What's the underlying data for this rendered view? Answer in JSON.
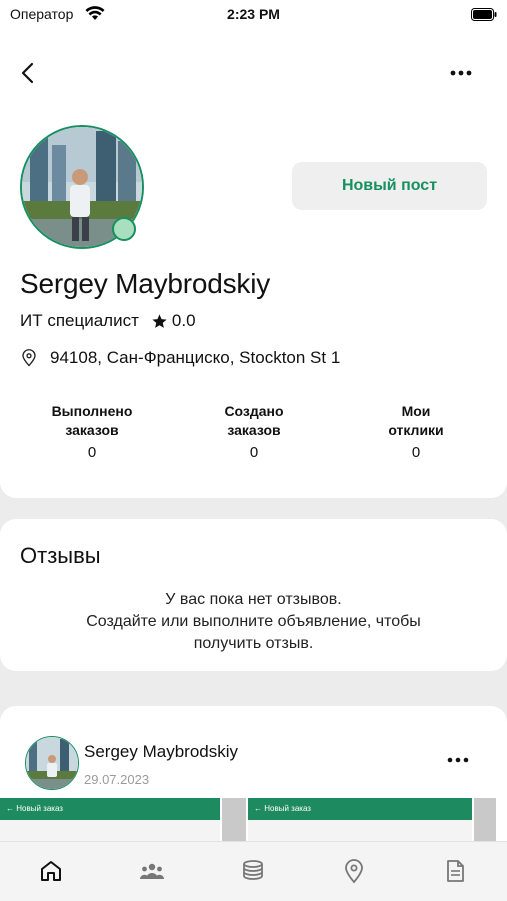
{
  "status_bar": {
    "carrier": "Оператор",
    "time": "2:23 PM"
  },
  "profile": {
    "name": "Sergey Maybrodskiy",
    "profession": "ИТ специалист",
    "rating": "0.0",
    "location": "94108, Сан-Франциско, Stockton St 1",
    "new_post_label": "Новый пост",
    "stats": [
      {
        "label_line1": "Выполнено",
        "label_line2": "заказов",
        "value": "0"
      },
      {
        "label_line1": "Создано",
        "label_line2": "заказов",
        "value": "0"
      },
      {
        "label_line1": "Мои",
        "label_line2": "отклики",
        "value": "0"
      }
    ]
  },
  "reviews": {
    "title": "Отзывы",
    "empty_line1": "У вас пока нет отзывов.",
    "empty_line2": "Создайте или выполните объявление, чтобы",
    "empty_line3": "получить отзыв."
  },
  "post": {
    "author": "Sergey Maybrodskiy",
    "date": "29.07.2023",
    "thumb_titles": [
      "Новый заказ",
      "Новый заказ"
    ]
  },
  "tabs": [
    "home-icon",
    "people-icon",
    "coins-icon",
    "location-icon",
    "document-icon"
  ],
  "colors": {
    "accent": "#17905f",
    "online": "#a9dfbf"
  }
}
